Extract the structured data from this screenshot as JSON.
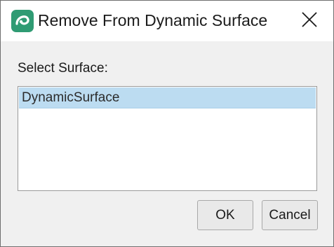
{
  "dialog": {
    "title": "Remove From Dynamic Surface",
    "app_icon": "app-logo-icon",
    "close_icon": "close-icon",
    "label": "Select Surface:",
    "surfaces": [
      "DynamicSurface"
    ],
    "selected_index": 0,
    "ok_label": "OK",
    "cancel_label": "Cancel"
  },
  "colors": {
    "selection": "#bcdcf1",
    "app_icon_green": "#2f9b73",
    "app_icon_teal": "#2aa6a0"
  }
}
